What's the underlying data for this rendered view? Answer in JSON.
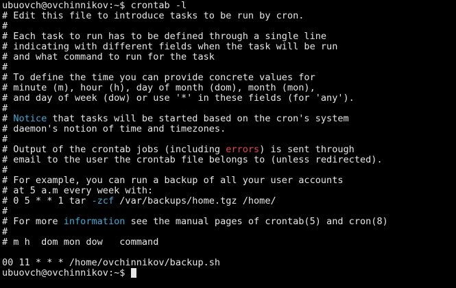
{
  "terminal": {
    "lines": [
      [
        {
          "t": "ubuovch@ovchinnikov:~$ crontab -l"
        }
      ],
      [
        {
          "t": "# Edit this file to introduce tasks to be run by cron."
        }
      ],
      [
        {
          "t": "#"
        }
      ],
      [
        {
          "t": "# Each task to run has to be defined through a single line"
        }
      ],
      [
        {
          "t": "# indicating with different fields when the task will be run"
        }
      ],
      [
        {
          "t": "# and what command to run for the task"
        }
      ],
      [
        {
          "t": "#"
        }
      ],
      [
        {
          "t": "# To define the time you can provide concrete values for"
        }
      ],
      [
        {
          "t": "# minute (m), hour (h), day of month (dom), month (mon),"
        }
      ],
      [
        {
          "t": "# and day of week (dow) or use '*' in these fields (for 'any')."
        }
      ],
      [
        {
          "t": "#"
        }
      ],
      [
        {
          "t": "# "
        },
        {
          "t": "Notice",
          "c": "#3fa9d4"
        },
        {
          "t": " that tasks will be started based on the cron's system"
        }
      ],
      [
        {
          "t": "# daemon's notion of time and timezones."
        }
      ],
      [
        {
          "t": "#"
        }
      ],
      [
        {
          "t": "# Output of the crontab jobs (including "
        },
        {
          "t": "errors",
          "c": "#e04a4a"
        },
        {
          "t": ") is sent through"
        }
      ],
      [
        {
          "t": "# email to the user the crontab file belongs to (unless redirected)."
        }
      ],
      [
        {
          "t": "#"
        }
      ],
      [
        {
          "t": "# For example, you can run a backup of all your user accounts"
        }
      ],
      [
        {
          "t": "# at 5 a.m every week with:"
        }
      ],
      [
        {
          "t": "# 0 5 * * 1 tar "
        },
        {
          "t": "-zcf",
          "c": "#3fa9d4"
        },
        {
          "t": " /var/backups/home.tgz /home/"
        }
      ],
      [
        {
          "t": "#"
        }
      ],
      [
        {
          "t": "# For more "
        },
        {
          "t": "information",
          "c": "#3fa9d4"
        },
        {
          "t": " see the manual pages of crontab(5) and cron(8)"
        }
      ],
      [
        {
          "t": "#"
        }
      ],
      [
        {
          "t": "# m h  dom mon dow   command"
        }
      ],
      [
        {
          "t": ""
        }
      ],
      [
        {
          "t": "00 11 * * * /home/ovchinnikov/backup.sh"
        }
      ],
      [
        {
          "t": "ubuovch@ovchinnikov:~$ "
        }
      ]
    ]
  },
  "colors": {
    "background": "#000000",
    "foreground": "#e6e6e6",
    "keyword_blue": "#3fa9d4",
    "error_red": "#e04a4a"
  }
}
